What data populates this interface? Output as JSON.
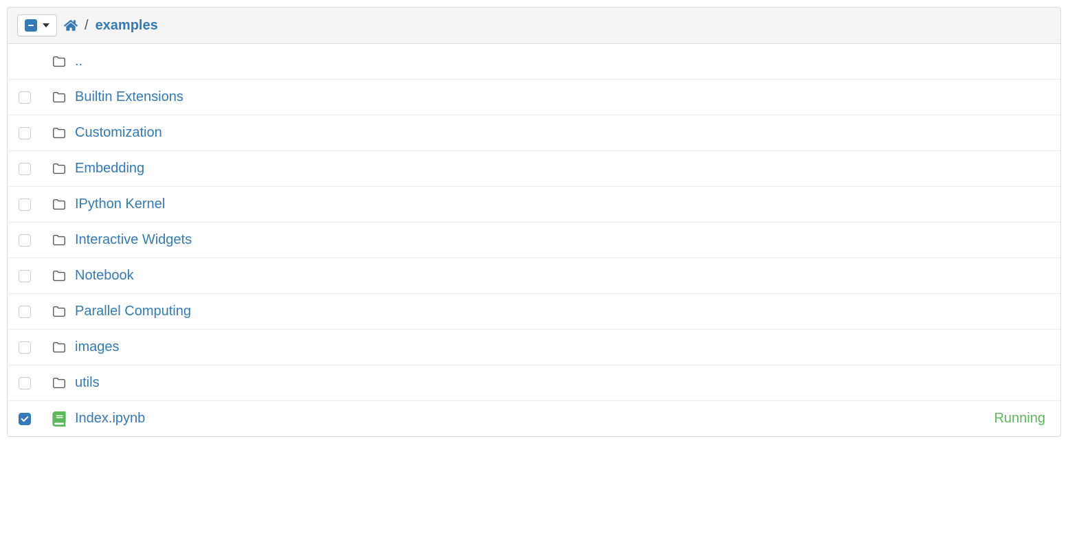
{
  "breadcrumb": {
    "separator": "/",
    "current": "examples"
  },
  "items": [
    {
      "name": "..",
      "type": "folder-up",
      "checked": false,
      "checkbox": false,
      "status": null
    },
    {
      "name": "Builtin Extensions",
      "type": "folder",
      "checked": false,
      "checkbox": true,
      "status": null
    },
    {
      "name": "Customization",
      "type": "folder",
      "checked": false,
      "checkbox": true,
      "status": null
    },
    {
      "name": "Embedding",
      "type": "folder",
      "checked": false,
      "checkbox": true,
      "status": null
    },
    {
      "name": "IPython Kernel",
      "type": "folder",
      "checked": false,
      "checkbox": true,
      "status": null
    },
    {
      "name": "Interactive Widgets",
      "type": "folder",
      "checked": false,
      "checkbox": true,
      "status": null
    },
    {
      "name": "Notebook",
      "type": "folder",
      "checked": false,
      "checkbox": true,
      "status": null
    },
    {
      "name": "Parallel Computing",
      "type": "folder",
      "checked": false,
      "checkbox": true,
      "status": null
    },
    {
      "name": "images",
      "type": "folder",
      "checked": false,
      "checkbox": true,
      "status": null
    },
    {
      "name": "utils",
      "type": "folder",
      "checked": false,
      "checkbox": true,
      "status": null
    },
    {
      "name": "Index.ipynb",
      "type": "notebook",
      "checked": true,
      "checkbox": true,
      "status": "Running"
    }
  ]
}
